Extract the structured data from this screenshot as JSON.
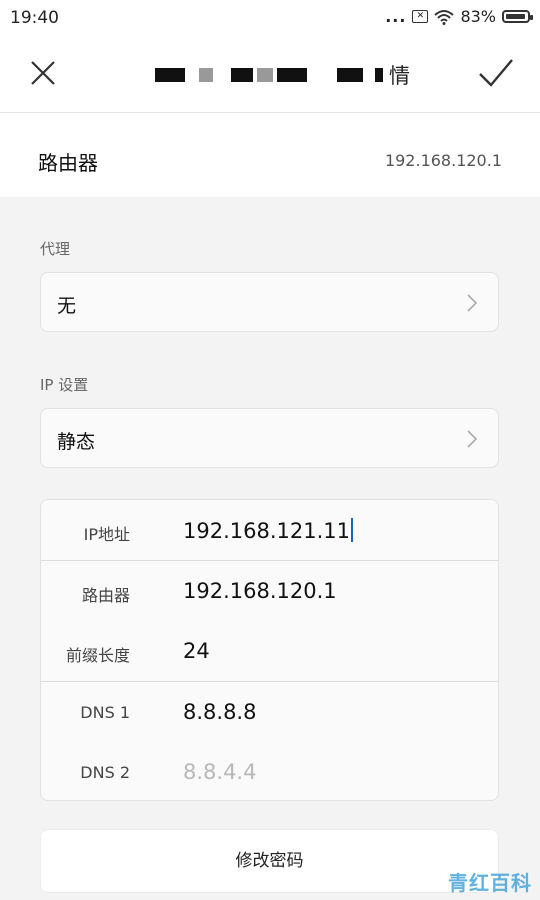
{
  "status_bar": {
    "time": "19:40",
    "dots": "...",
    "battery_percent": "83%",
    "icons": [
      "sim-off-icon",
      "wifi-icon",
      "battery-icon"
    ]
  },
  "header": {
    "title_suffix": "情",
    "close_icon": "close-icon",
    "confirm_icon": "check-icon"
  },
  "router": {
    "label": "路由器",
    "value": "192.168.120.1"
  },
  "proxy": {
    "section_label": "代理",
    "value": "无"
  },
  "ip_settings": {
    "section_label": "IP 设置",
    "value": "静态"
  },
  "ip_fields": [
    {
      "label": "IP地址",
      "value": "192.168.121.11"
    },
    {
      "label": "路由器",
      "value": "192.168.120.1"
    },
    {
      "label": "前缀长度",
      "value": "24"
    },
    {
      "label": "DNS 1",
      "value": "8.8.8.8"
    },
    {
      "label": "DNS 2",
      "placeholder": "8.8.4.4"
    }
  ],
  "change_password_label": "修改密码",
  "watermark": "青红百科",
  "colors": {
    "accent_cursor": "#1565c0",
    "watermark": "#3aa0d8"
  }
}
